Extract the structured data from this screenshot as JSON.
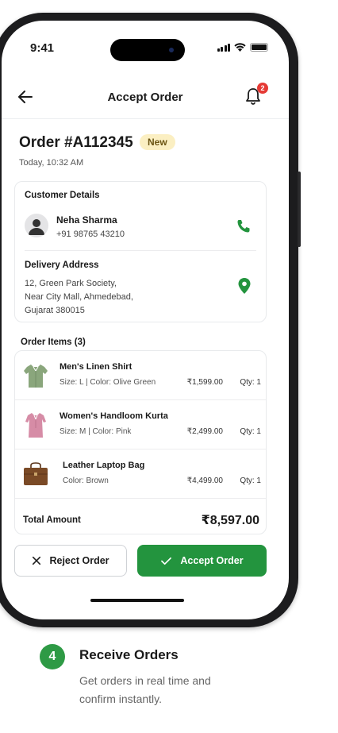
{
  "status_bar": {
    "time": "9:41"
  },
  "header": {
    "title": "Accept Order",
    "notification_count": "2"
  },
  "order": {
    "title": "Order #A112345",
    "status": "New",
    "timestamp": "Today, 10:32 AM"
  },
  "customer": {
    "section_label": "Customer Details",
    "name": "Neha Sharma",
    "phone": "+91 98765 43210"
  },
  "delivery": {
    "section_label": "Delivery Address",
    "address_lines": [
      "12, Green Park Society,",
      "Near City Mall, Ahmedebad,",
      "Gujarat 380015"
    ]
  },
  "items": {
    "section_label": "Order Items (3)",
    "list": [
      {
        "name": "Men's Linen Shirt",
        "meta": "Size: L  |  Color: Olive Green",
        "price": "₹1,599.00",
        "qty": "Qty: 1",
        "icon": "shirt-icon"
      },
      {
        "name": "Women's Handloom Kurta",
        "meta": "Size: M  |  Color: Pink",
        "price": "₹2,499.00",
        "qty": "Qty: 1",
        "icon": "kurta-icon"
      },
      {
        "name": "Leather Laptop Bag",
        "meta": "Color: Brown",
        "price": "₹4,499.00",
        "qty": "Qty: 1",
        "icon": "bag-icon"
      }
    ],
    "total_label": "Total Amount",
    "total_value": "₹8,597.00"
  },
  "actions": {
    "reject_label": "Reject Order",
    "accept_label": "Accept Order"
  },
  "caption": {
    "step_number": "4",
    "title": "Receive Orders",
    "description": "Get orders in real time and confirm instantly."
  },
  "colors": {
    "accent_green": "#23943e",
    "badge_red": "#e53935",
    "new_pill": "#fbefc2"
  }
}
